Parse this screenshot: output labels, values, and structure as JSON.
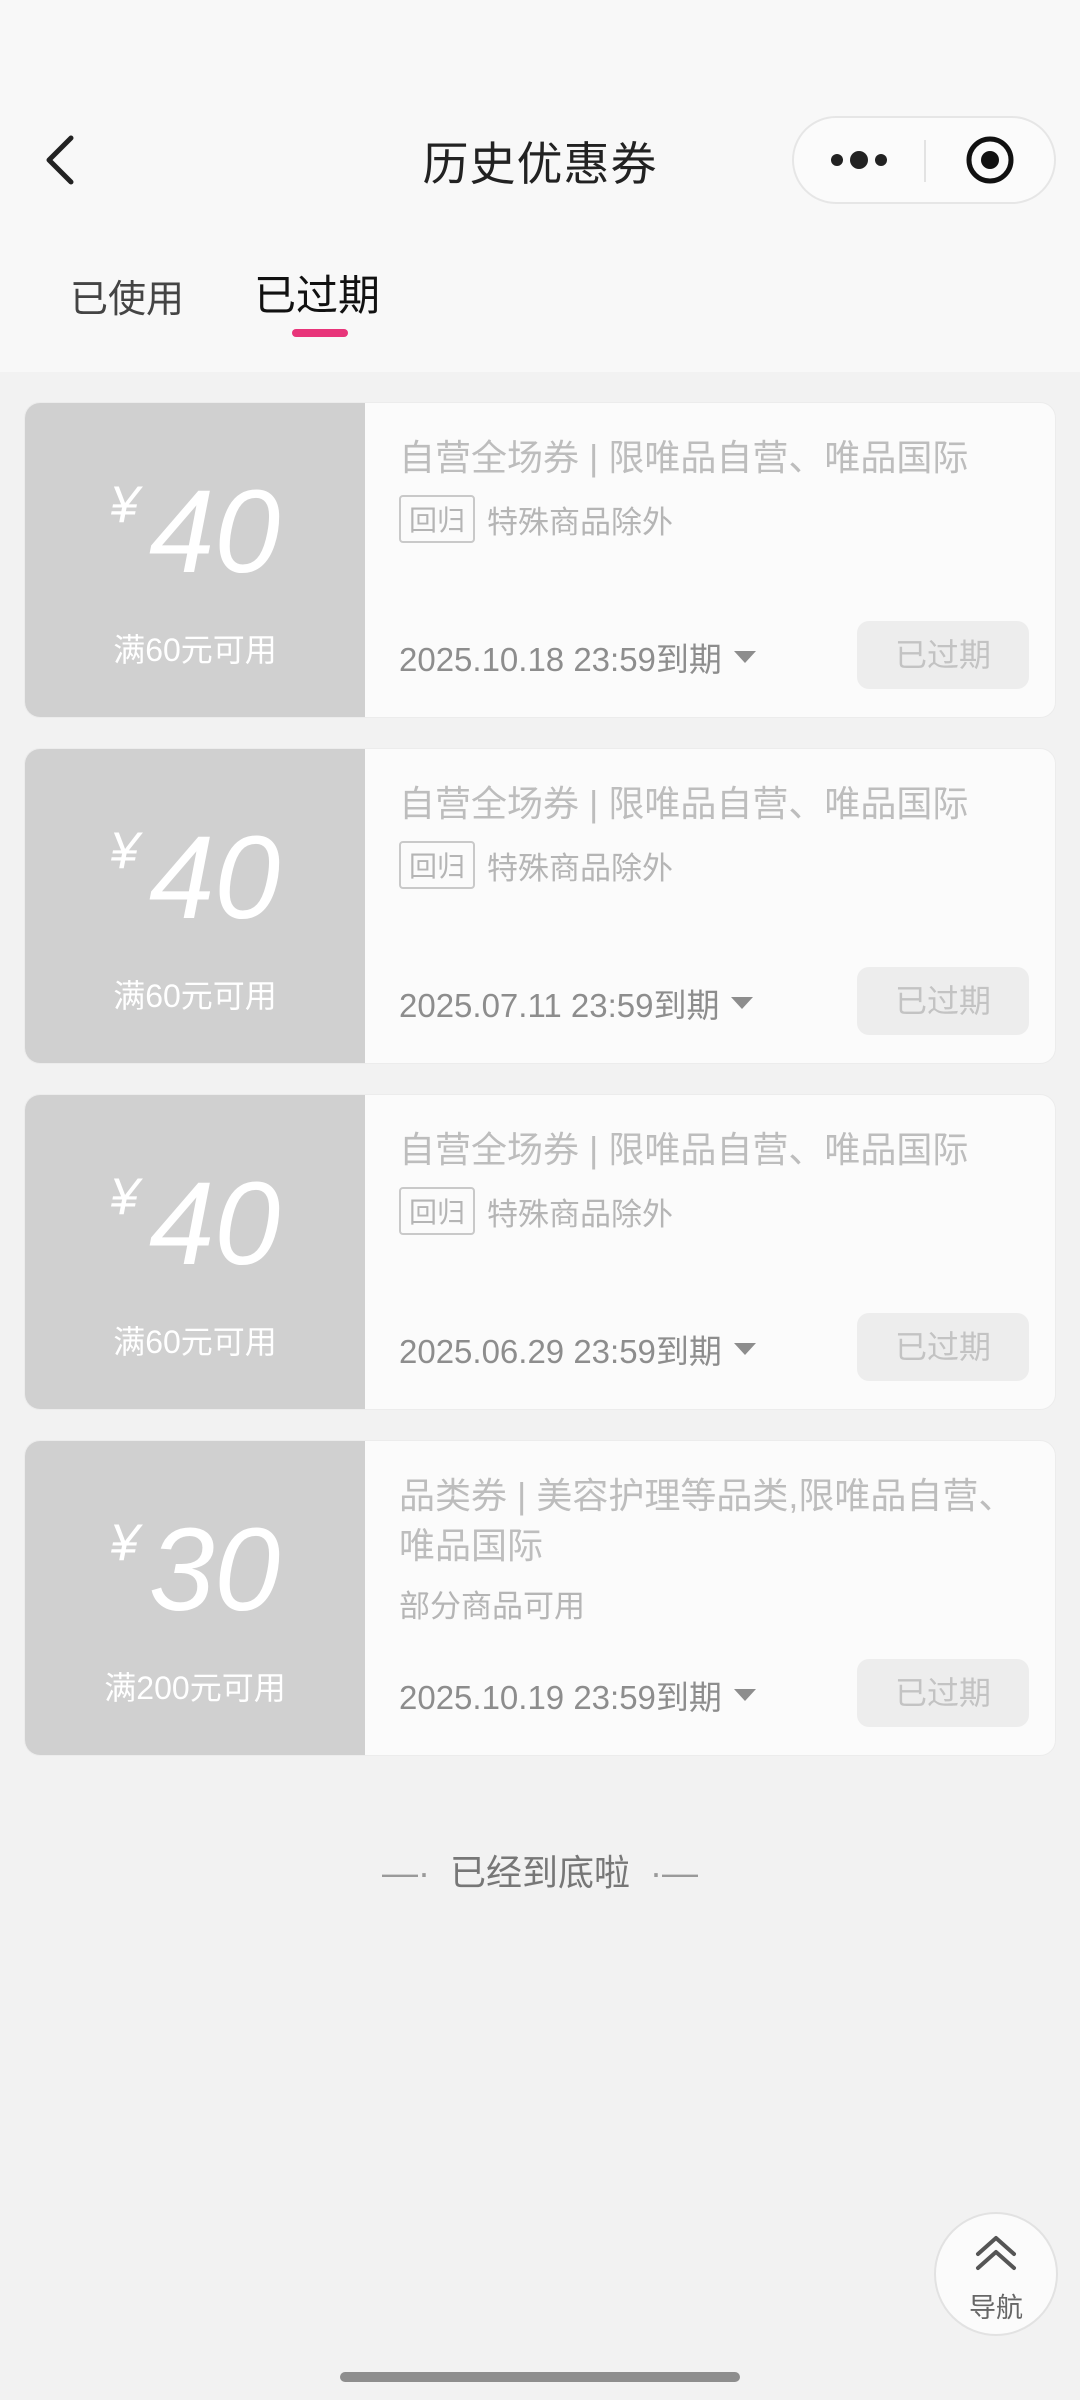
{
  "header": {
    "title": "历史优惠券",
    "back_icon": "chevron-left-icon",
    "more_icon": "more-dots-icon",
    "close_icon": "target-circle-icon"
  },
  "tabs": [
    {
      "label": "已使用",
      "active": false
    },
    {
      "label": "已过期",
      "active": true
    }
  ],
  "accent_color": "#e8357a",
  "coupons": [
    {
      "currency": "¥",
      "amount": "40",
      "threshold": "满60元可用",
      "title": "自营全场券 | 限唯品自营、唯品国际",
      "tag": "回归",
      "note": "特殊商品除外",
      "expiry": "2025.10.18 23:59到期",
      "status": "已过期"
    },
    {
      "currency": "¥",
      "amount": "40",
      "threshold": "满60元可用",
      "title": "自营全场券 | 限唯品自营、唯品国际",
      "tag": "回归",
      "note": "特殊商品除外",
      "expiry": "2025.07.11 23:59到期",
      "status": "已过期"
    },
    {
      "currency": "¥",
      "amount": "40",
      "threshold": "满60元可用",
      "title": "自营全场券 | 限唯品自营、唯品国际",
      "tag": "回归",
      "note": "特殊商品除外",
      "expiry": "2025.06.29 23:59到期",
      "status": "已过期"
    },
    {
      "currency": "¥",
      "amount": "30",
      "threshold": "满200元可用",
      "title": "品类券 | 美容护理等品类,限唯品自营、唯品国际",
      "note": "部分商品可用",
      "expiry": "2025.10.19 23:59到期",
      "status": "已过期"
    }
  ],
  "end_text": "已经到底啦",
  "nav_button": {
    "label": "导航",
    "icon": "double-chevron-up-icon"
  }
}
